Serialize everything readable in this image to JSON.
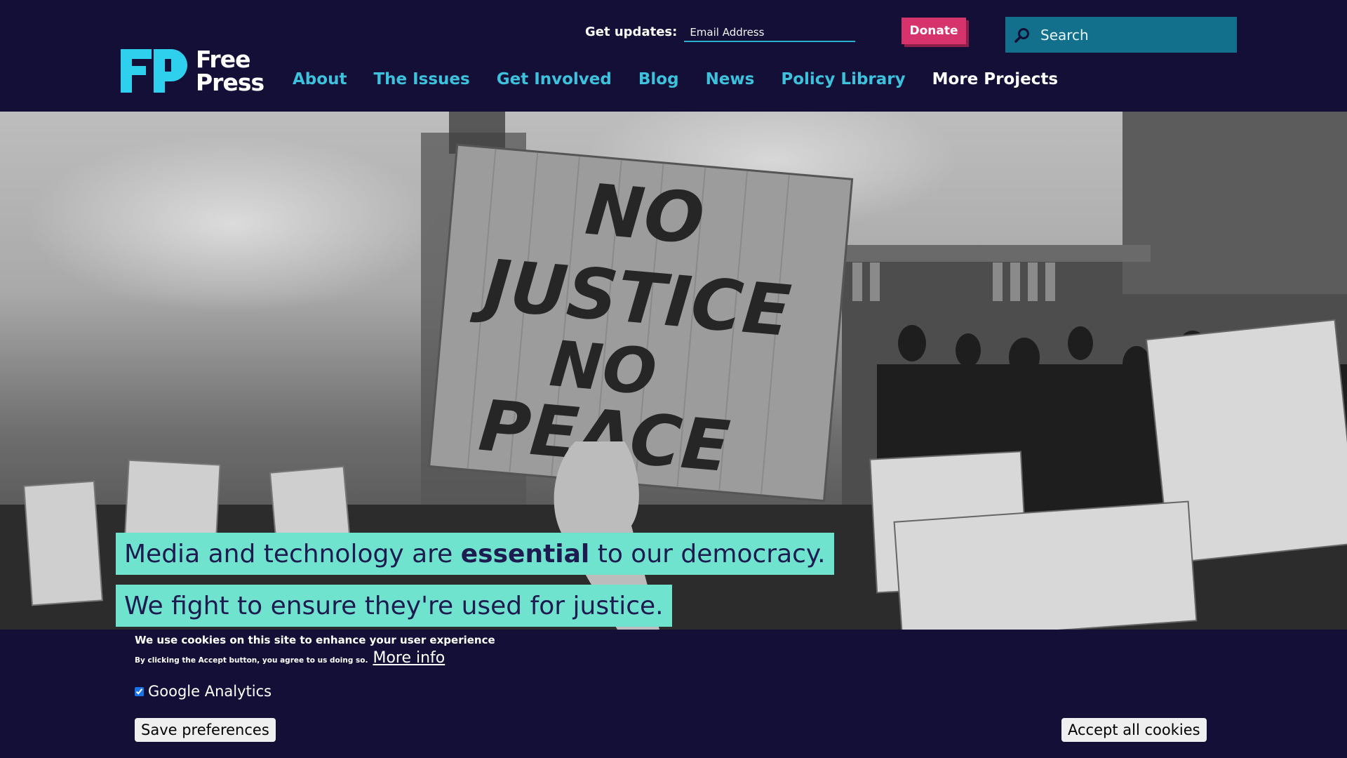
{
  "header": {
    "logo": {
      "line1": "Free",
      "line2": "Press",
      "mark": "FP"
    },
    "updates_label": "Get updates:",
    "email_placeholder": "Email Address",
    "donate_label": "Donate",
    "search_placeholder": "Search"
  },
  "nav": {
    "items": [
      {
        "label": "About"
      },
      {
        "label": "The Issues"
      },
      {
        "label": "Get Involved"
      },
      {
        "label": "Blog"
      },
      {
        "label": "News"
      },
      {
        "label": "Policy Library"
      },
      {
        "label": "More Projects"
      }
    ]
  },
  "hero": {
    "tagline1_pre": "Media and technology are",
    "tagline1_bold": "essential",
    "tagline1_post": "to our democracy.",
    "tagline2": "We fight to ensure they're used for justice.",
    "sign_text": [
      "NO",
      "JUSTICE",
      "NO",
      "PEACE"
    ]
  },
  "cookie": {
    "title": "We use cookies on this site to enhance your user experience",
    "small": "By clicking the Accept button, you agree to us doing so.",
    "more_info": "More info",
    "ga_label": "Google Analytics",
    "ga_checked": true,
    "save_label": "Save preferences",
    "accept_label": "Accept all cookies"
  },
  "colors": {
    "bg": "#140f36",
    "accent_teal": "#3cc2dc",
    "donate": "#d6336c",
    "search_bg": "#13708c",
    "tagline_bg": "#70e3cf",
    "tagline_text": "#1d1b4f"
  }
}
